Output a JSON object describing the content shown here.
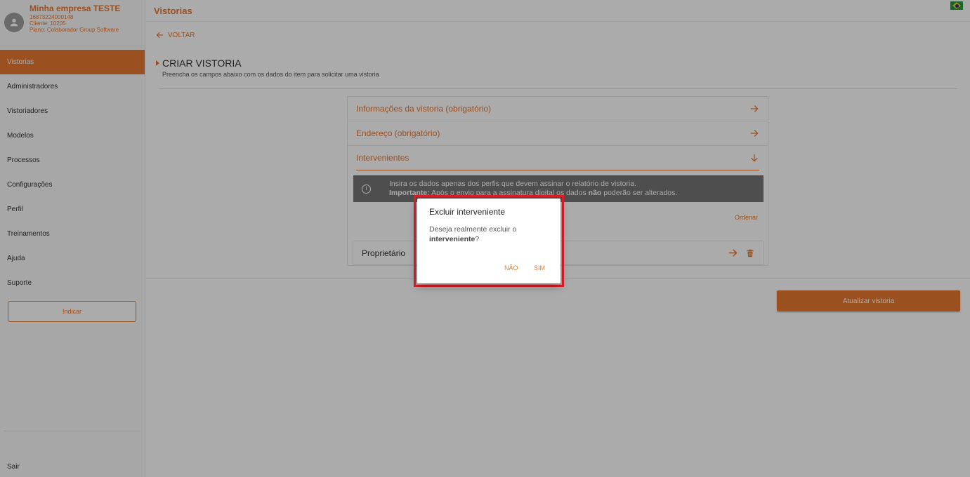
{
  "profile": {
    "company": "Minha empresa TESTE",
    "id_line": "16873224000148",
    "client_line": "Cliente: 10205",
    "plan_line": "Plano: Colaborador Group Software"
  },
  "nav": {
    "items": [
      "Vistorias",
      "Administradores",
      "Vistoriadores",
      "Modelos",
      "Processos",
      "Configurações",
      "Perfil",
      "Treinamentos",
      "Ajuda",
      "Suporte"
    ],
    "active": "Vistorias",
    "indicar_label": "Indicar",
    "sair_label": "Sair"
  },
  "topbar": {
    "title": "Vistorias",
    "flag": "brazil-flag-icon"
  },
  "back_label": "VOLTAR",
  "page": {
    "title": "CRIAR VISTORIA",
    "subtitle": "Preencha os campos abaixo com os dados do item para solicitar uma vistoria"
  },
  "accordion": {
    "info_label": "Informações da vistoria (obrigatório)",
    "address_label": "Endereço (obrigatório)",
    "intervenientes_label": "Intervenientes"
  },
  "notice": {
    "line1": "Insira os dados apenas dos perfis que devem assinar o relatório de vistoria.",
    "line2_strong": "Importante:",
    "line2_rest_a": " Após o envio para a assinatura digital os dados ",
    "line2_bold": "não",
    "line2_rest_b": " poderão ser alterados."
  },
  "ordenar_label": "Ordenar",
  "proprietario_label": "Proprietário",
  "update_button": "Atualizar vistoria",
  "dialog": {
    "title": "Excluir interveniente",
    "text_a": "Deseja realmente excluir o ",
    "text_bold": "interveniente",
    "text_b": "?",
    "no_label": "NÃO",
    "yes_label": "SIM"
  },
  "colors": {
    "accent": "#e8782f",
    "highlight": "#e11f26"
  }
}
